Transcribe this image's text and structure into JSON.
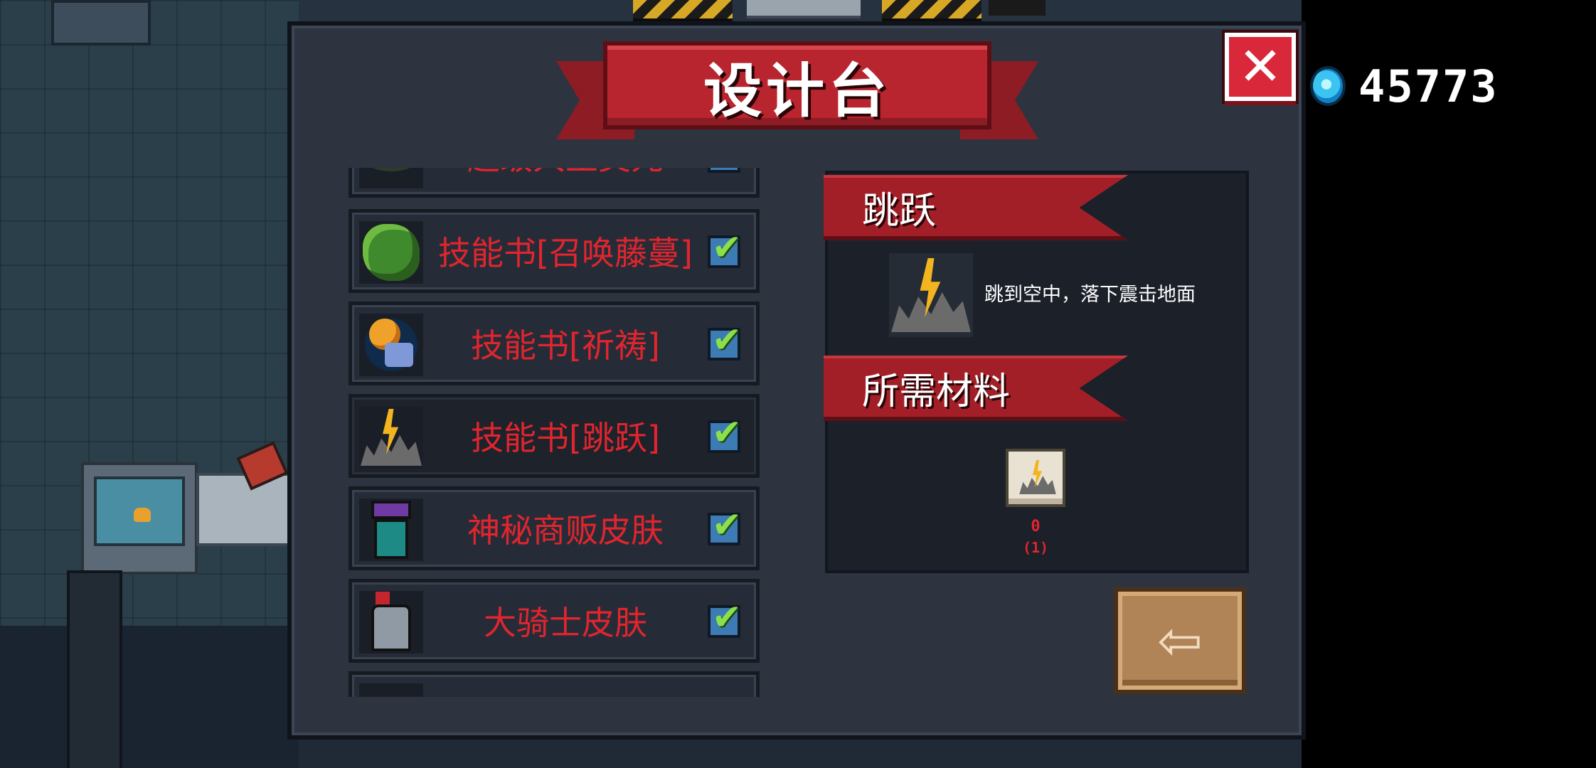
{
  "title": "设计台",
  "currency": {
    "icon": "gem-icon",
    "value": "45773"
  },
  "close_icon": "✕",
  "recipes": [
    {
      "label": "超级大王美元",
      "icon": "skill-book-icon",
      "checked": true
    },
    {
      "label": "技能书[召唤藤蔓]",
      "icon": "vine-icon",
      "checked": true
    },
    {
      "label": "技能书[祈祷]",
      "icon": "praying-hand-icon",
      "checked": true
    },
    {
      "label": "技能书[跳跃]",
      "icon": "jump-burst-icon",
      "checked": true,
      "selected": true
    },
    {
      "label": "神秘商贩皮肤",
      "icon": "merchant-icon",
      "checked": true
    },
    {
      "label": "大骑士皮肤",
      "icon": "knight-icon",
      "checked": true
    }
  ],
  "check_glyph": "✔",
  "detail": {
    "name": "跳跃",
    "description": "跳到空中，落下震击地面",
    "materials_heading": "所需材料",
    "material": {
      "icon": "skill-scroll-icon",
      "count": "0",
      "required": "(1)"
    }
  },
  "exit_icon": "⇦",
  "colors": {
    "panel": "#2d3440",
    "ribbon": "#b8252e",
    "recipe_text": "#e0252e",
    "exit_button": "#b08457"
  }
}
